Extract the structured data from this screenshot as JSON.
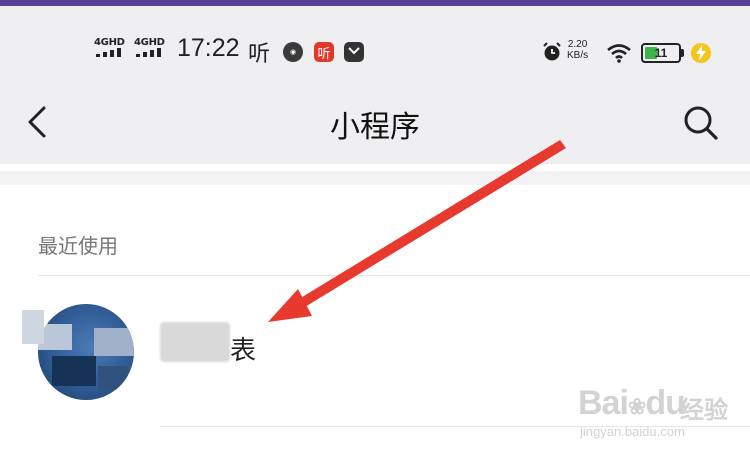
{
  "status_bar": {
    "network_1": "4GHD",
    "network_2": "4GHD",
    "time": "17:22",
    "ting_label": "听",
    "speed_value": "2.20",
    "speed_unit": "KB/s",
    "battery_level": "11",
    "colors": {
      "ting_app": "#e2382c",
      "dark_app": "#333333",
      "charge": "#f5c518",
      "battery_fill": "#3bb54a"
    }
  },
  "nav": {
    "title": "小程序",
    "back_icon": "chevron-left-icon",
    "search_icon": "search-icon"
  },
  "recent": {
    "section_label": "最近使用",
    "items": [
      {
        "label": "表",
        "avatar_icon": "mini-program-avatar"
      }
    ]
  },
  "annotation": {
    "arrow_color": "#e8392f"
  },
  "watermark": {
    "brand": "Bai",
    "brand_suffix": "du",
    "cn": "经验",
    "url": "jingyan.baidu.com"
  }
}
